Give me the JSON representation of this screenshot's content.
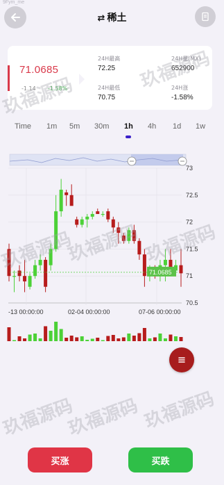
{
  "watermark_small": "9Fym_me",
  "header": {
    "swap_icon": "⇄",
    "title": "稀土"
  },
  "ticker": {
    "price": "71.0685",
    "change": "-1.14",
    "change_pct": "-1.58%",
    "stats": [
      {
        "label": "24H最高",
        "value": "72.25"
      },
      {
        "label": "24H量(MX)",
        "value": "652900"
      },
      {
        "label": "24H最低",
        "value": "70.75"
      },
      {
        "label": "24H涨",
        "value": "-1.58%"
      }
    ]
  },
  "tabs": [
    "Time",
    "1m",
    "5m",
    "30m",
    "1h",
    "4h",
    "1d",
    "1w"
  ],
  "active_tab": "1h",
  "chart_data": {
    "type": "candlestick",
    "y_ticks": [
      "73",
      "72.5",
      "72",
      "71.5",
      "71",
      "70.5"
    ],
    "ylim": [
      70.5,
      73
    ],
    "x_ticks": [
      "-13 00:00:00",
      "02-04 00:00:00",
      "07-06 00:00:00"
    ],
    "last_price_label": "71.0685",
    "colors": {
      "up": "#4cd137",
      "down": "#b71c1c"
    },
    "candles": [
      {
        "o": 71.5,
        "h": 71.6,
        "l": 70.9,
        "c": 71.0
      },
      {
        "o": 71.0,
        "h": 71.1,
        "l": 70.7,
        "c": 71.0
      },
      {
        "o": 71.1,
        "h": 71.2,
        "l": 70.9,
        "c": 71.0
      },
      {
        "o": 71.0,
        "h": 71.3,
        "l": 70.7,
        "c": 70.9
      },
      {
        "o": 70.8,
        "h": 71.05,
        "l": 70.75,
        "c": 71.0
      },
      {
        "o": 71.0,
        "h": 71.3,
        "l": 70.95,
        "c": 71.2
      },
      {
        "o": 71.2,
        "h": 71.4,
        "l": 71.1,
        "c": 71.3
      },
      {
        "o": 71.3,
        "h": 71.35,
        "l": 70.7,
        "c": 70.8
      },
      {
        "o": 71.2,
        "h": 71.6,
        "l": 71.1,
        "c": 71.5
      },
      {
        "o": 71.5,
        "h": 72.5,
        "l": 71.45,
        "c": 72.2
      },
      {
        "o": 72.2,
        "h": 72.8,
        "l": 72.1,
        "c": 72.6
      },
      {
        "o": 72.55,
        "h": 72.6,
        "l": 72.3,
        "c": 72.5
      },
      {
        "o": 72.5,
        "h": 72.7,
        "l": 72.35,
        "c": 72.3
      },
      {
        "o": 72.05,
        "h": 72.1,
        "l": 71.9,
        "c": 71.95
      },
      {
        "o": 71.95,
        "h": 72.1,
        "l": 71.9,
        "c": 72.05
      },
      {
        "o": 72.05,
        "h": 72.15,
        "l": 71.9,
        "c": 72.1
      },
      {
        "o": 72.1,
        "h": 72.2,
        "l": 72.05,
        "c": 72.15
      },
      {
        "o": 72.2,
        "h": 72.25,
        "l": 72.15,
        "c": 72.15
      },
      {
        "o": 72.15,
        "h": 72.2,
        "l": 72.1,
        "c": 72.15
      },
      {
        "o": 72.2,
        "h": 72.25,
        "l": 72.0,
        "c": 72.05
      },
      {
        "o": 72.05,
        "h": 72.1,
        "l": 71.8,
        "c": 71.9
      },
      {
        "o": 71.9,
        "h": 72.0,
        "l": 71.6,
        "c": 71.8
      },
      {
        "o": 71.75,
        "h": 71.8,
        "l": 71.6,
        "c": 71.65
      },
      {
        "o": 71.65,
        "h": 71.9,
        "l": 71.6,
        "c": 71.85
      },
      {
        "o": 71.85,
        "h": 71.95,
        "l": 71.6,
        "c": 71.65
      },
      {
        "o": 71.65,
        "h": 71.7,
        "l": 71.3,
        "c": 71.4
      },
      {
        "o": 71.4,
        "h": 71.5,
        "l": 70.8,
        "c": 71.0
      },
      {
        "o": 71.0,
        "h": 71.2,
        "l": 70.9,
        "c": 71.1
      },
      {
        "o": 71.1,
        "h": 71.2,
        "l": 70.95,
        "c": 71.0
      },
      {
        "o": 71.0,
        "h": 71.3,
        "l": 70.9,
        "c": 71.2
      },
      {
        "o": 71.2,
        "h": 71.5,
        "l": 70.9,
        "c": 71.3
      },
      {
        "o": 71.3,
        "h": 71.5,
        "l": 71.0,
        "c": 71.1
      },
      {
        "o": 71.1,
        "h": 71.3,
        "l": 71.0,
        "c": 71.2
      },
      {
        "o": 71.2,
        "h": 71.5,
        "l": 70.8,
        "c": 71.05
      }
    ]
  },
  "fab_icon": "menu-icon",
  "actions": {
    "buy_label": "买涨",
    "sell_label": "买跌"
  },
  "watermark_text": "玖福源码"
}
